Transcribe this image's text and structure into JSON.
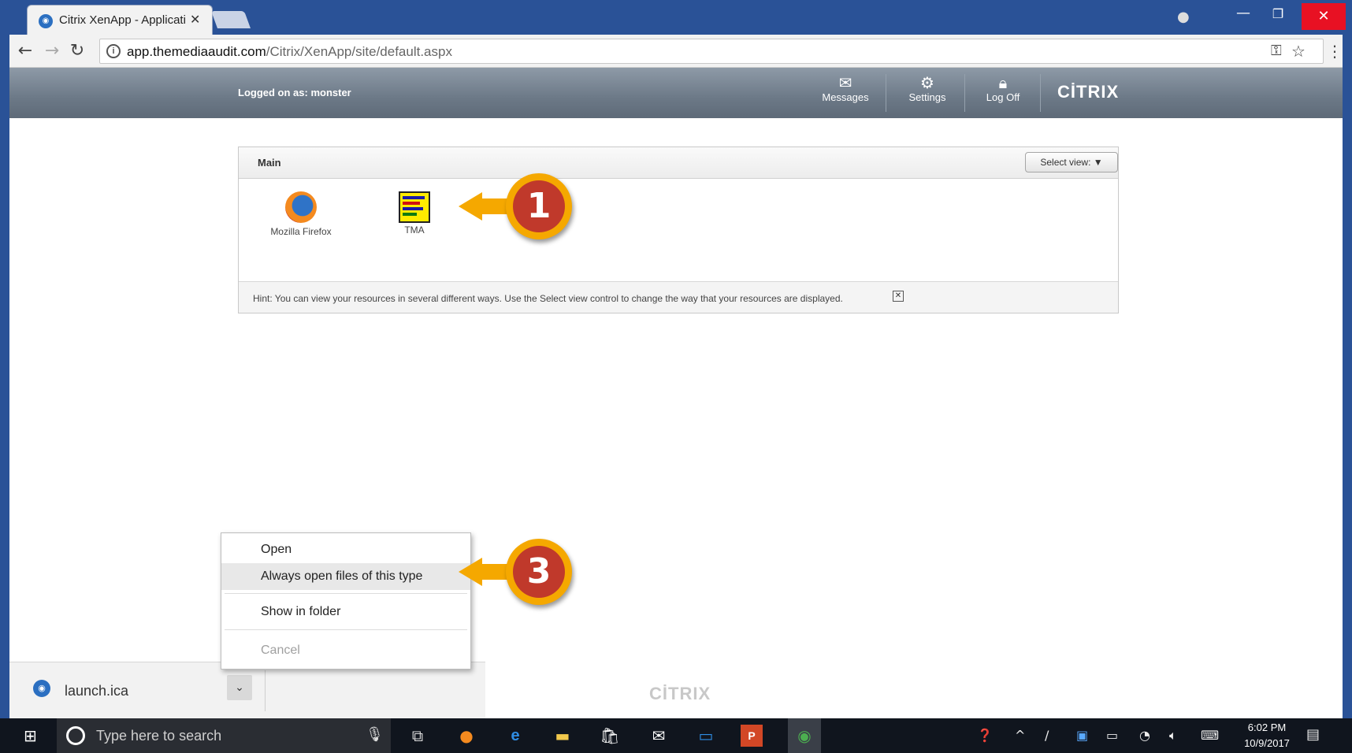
{
  "browser": {
    "tab_title": "Citrix XenApp - Applicati",
    "tab_close": "✕",
    "url_host": "app.themediaaudit.com",
    "url_path": "/Citrix/XenApp/site/default.aspx"
  },
  "citrix_header": {
    "logged_on": "Logged on as: monster",
    "messages": "Messages",
    "settings": "Settings",
    "log_off": "Log Off",
    "logo": "CİTRIX"
  },
  "panel": {
    "title": "Main",
    "select_view": "Select view: ▼",
    "apps": [
      {
        "label": "Mozilla Firefox",
        "icon": "firefox-icon"
      },
      {
        "label": "TMA",
        "icon": "tma-icon"
      }
    ],
    "hint": "Hint: You can view your resources in several different ways. Use the Select view control to change the way that your resources are displayed.",
    "hint_close": "✕"
  },
  "callouts": [
    {
      "number": "1",
      "color": "#f5a800"
    },
    {
      "number": "3",
      "color": "#f5a800"
    }
  ],
  "context_menu": {
    "items": [
      {
        "label": "Open"
      },
      {
        "label": "Always open files of this type"
      },
      {
        "label": "Show in folder"
      },
      {
        "label": "Cancel"
      }
    ]
  },
  "download_shelf": {
    "file_name": "launch.ica"
  },
  "footer_logo": "CİTRIX",
  "taskbar": {
    "search_placeholder": "Type here to search",
    "time": "6:02 PM",
    "date": "10/9/2017"
  },
  "colors": {
    "accent_callout": "#f5a800",
    "callout_badge": "#c0392b",
    "window_frame": "#2a5297",
    "close_button": "#e81123"
  }
}
